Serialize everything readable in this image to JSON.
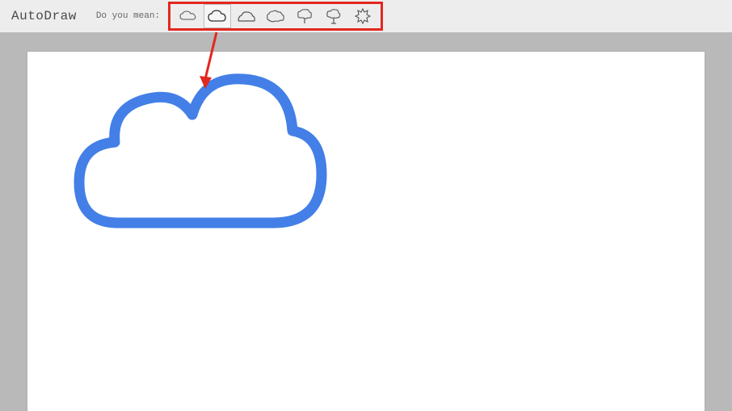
{
  "header": {
    "app_title": "AutoDraw",
    "prompt": "Do you mean:"
  },
  "suggestions": {
    "items": [
      {
        "name": "cloud-small-icon",
        "selected": false
      },
      {
        "name": "cloud-outline-icon",
        "selected": true
      },
      {
        "name": "cloud-half-icon",
        "selected": false
      },
      {
        "name": "cloud-puffy-icon",
        "selected": false
      },
      {
        "name": "cloud-tree1-icon",
        "selected": false
      },
      {
        "name": "cloud-tree2-icon",
        "selected": false
      },
      {
        "name": "badge-star-icon",
        "selected": false
      }
    ]
  },
  "canvas": {
    "drawing": "cloud",
    "stroke_color": "#437fe6"
  },
  "annotation": {
    "arrow_color": "#e3271e",
    "highlight_color": "#e3271e"
  }
}
